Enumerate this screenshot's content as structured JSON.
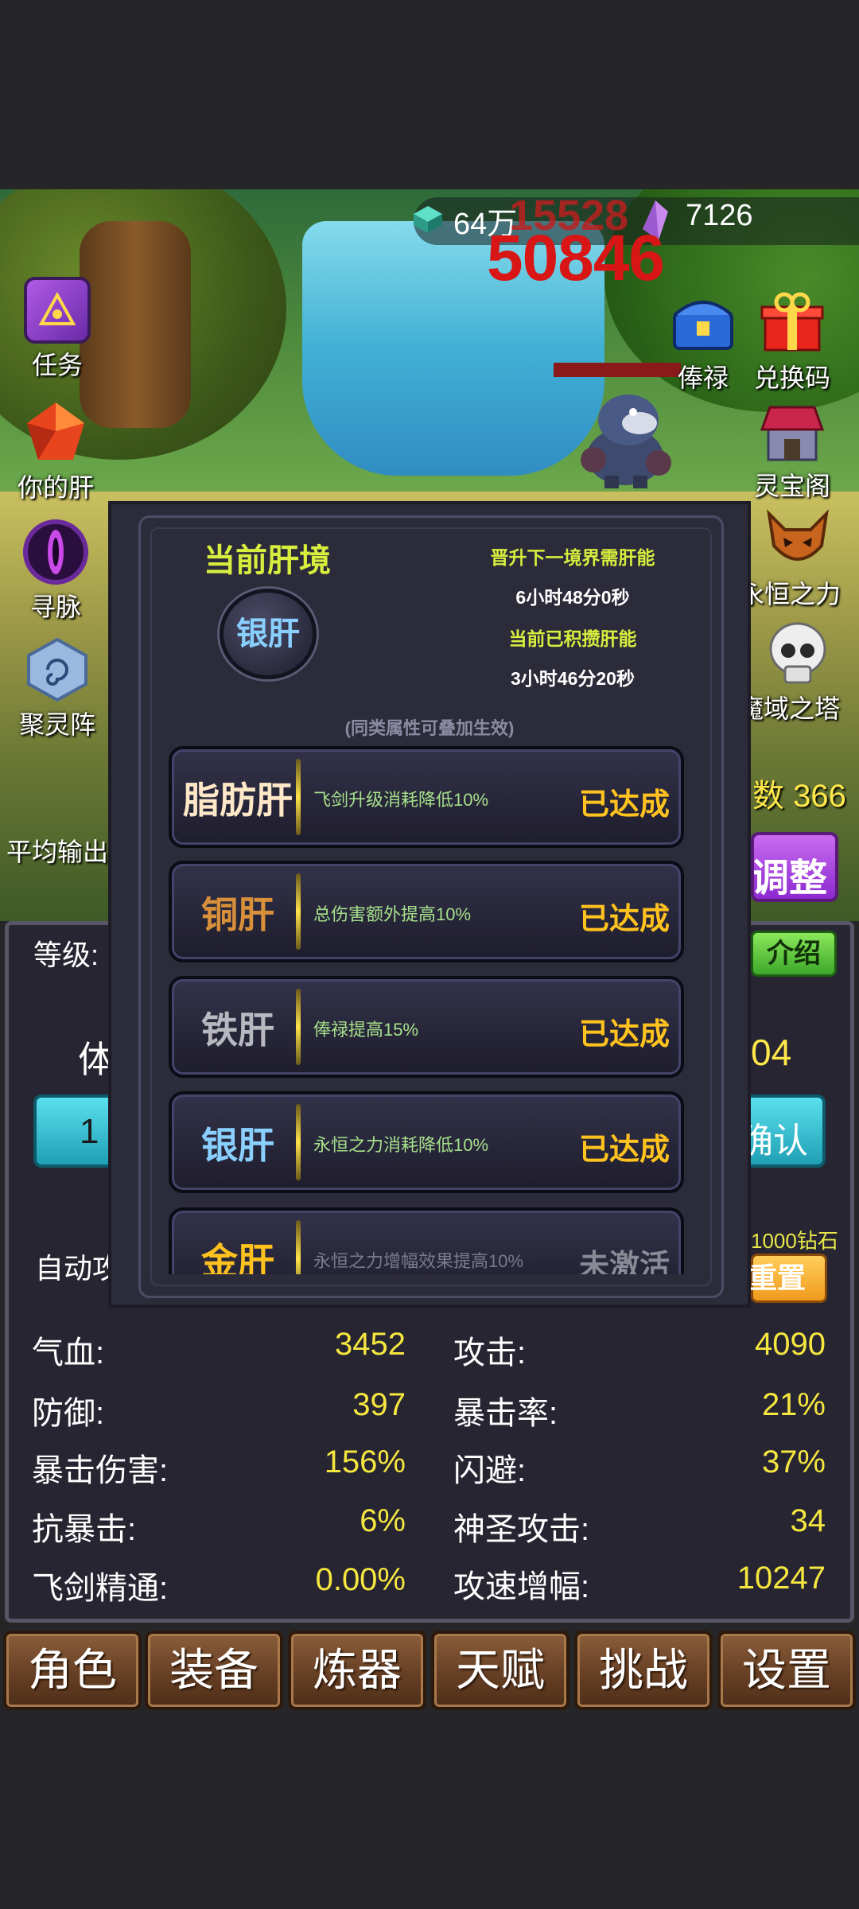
{
  "resources": {
    "crystal": "64万",
    "purple_gem": "7126"
  },
  "damage": {
    "small": "15528",
    "big": "50846"
  },
  "left_menu": [
    {
      "label": "任务",
      "icon": "quest-book-icon"
    },
    {
      "label": "你的肝",
      "icon": "red-gem-icon"
    },
    {
      "label": "寻脉",
      "icon": "purple-eye-icon"
    },
    {
      "label": "聚灵阵",
      "icon": "rune-stone-icon"
    }
  ],
  "right_menu": [
    {
      "label": "俸禄",
      "icon": "treasure-chest-icon"
    },
    {
      "label": "兑换码",
      "icon": "gift-box-icon"
    },
    {
      "label": "灵宝阁",
      "icon": "shop-icon"
    },
    {
      "label": "永恒之力",
      "icon": "demon-mask-icon"
    },
    {
      "label": "魔域之塔",
      "icon": "skull-icon"
    }
  ],
  "partial": {
    "count_text": "数 366",
    "avg_output": "平均输出",
    "adjust": "调整",
    "level": "等级:",
    "intro": "介绍",
    "ti": "体",
    "ti_right": "04",
    "left_btn": "1",
    "confirm": "确认",
    "diamond_cost": "1000钻石",
    "auto": "自动攻",
    "reset": "重置"
  },
  "stats": [
    {
      "k": "气血:",
      "v": "3452"
    },
    {
      "k": "攻击:",
      "v": "4090"
    },
    {
      "k": "防御:",
      "v": "397"
    },
    {
      "k": "暴击率:",
      "v": "21%"
    },
    {
      "k": "暴击伤害:",
      "v": "156%"
    },
    {
      "k": "闪避:",
      "v": "37%"
    },
    {
      "k": "抗暴击:",
      "v": "6%"
    },
    {
      "k": "神圣攻击:",
      "v": "34"
    },
    {
      "k": "飞剑精通:",
      "v": "0.00%"
    },
    {
      "k": "攻速增幅:",
      "v": "10247"
    }
  ],
  "nav": [
    "角色",
    "装备",
    "炼器",
    "天赋",
    "挑战",
    "设置"
  ],
  "modal": {
    "title": "当前肝境",
    "current_realm": "银肝",
    "next_label": "晋升下一境界需肝能",
    "next_value": "6小时48分0秒",
    "accum_label": "当前已积攒肝能",
    "accum_value": "3小时46分20秒",
    "stack_note": "(同类属性可叠加生效)",
    "tiers": [
      {
        "name": "脂肪肝",
        "desc": "飞剑升级消耗降低10%",
        "status": "已达成",
        "color": "#ffe8c8"
      },
      {
        "name": "铜肝",
        "desc": "总伤害额外提高10%",
        "status": "已达成",
        "color": "#d9903a"
      },
      {
        "name": "铁肝",
        "desc": "俸禄提高15%",
        "status": "已达成",
        "color": "#b8b8c0"
      },
      {
        "name": "银肝",
        "desc": "永恒之力消耗降低10%",
        "status": "已达成",
        "color": "#8ad0ff"
      },
      {
        "name": "金肝",
        "desc": "永恒之力增幅效果提高10%",
        "status": "未激活",
        "color": "#ffc21e"
      }
    ]
  }
}
